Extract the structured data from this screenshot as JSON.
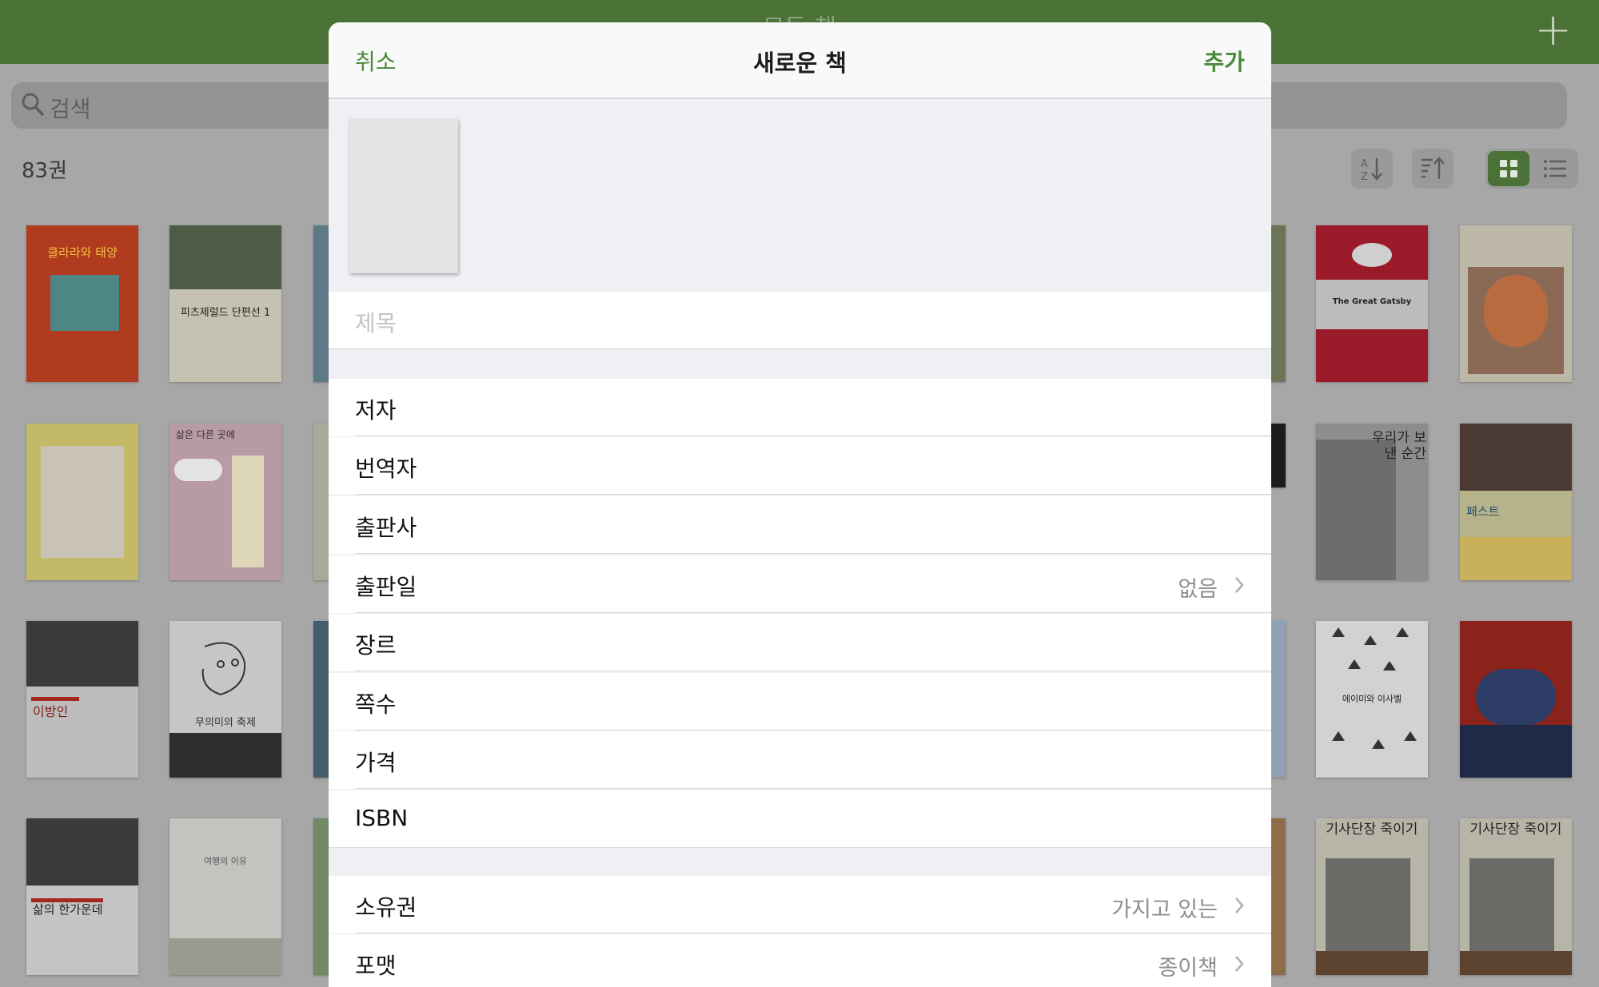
{
  "app": {
    "title": "모든 책",
    "search_placeholder": "검색",
    "book_count": "83권",
    "colors": {
      "accent": "#5a8a3c",
      "sheet_bg": "#efeff4"
    },
    "icons": [
      "plus-icon",
      "search-icon",
      "sort-alpha-icon",
      "sort-date-icon",
      "grid-view-icon",
      "list-view-icon"
    ]
  },
  "books": [
    {
      "title": "클라라와 태양"
    },
    {
      "title": "피츠제럴드 단편선 1"
    },
    {
      "title": "The Great Gatsby"
    },
    {
      "title": ""
    },
    {
      "title": ""
    },
    {
      "title": "삶은 다른 곳에"
    },
    {
      "title": "우리가 보낸 순간"
    },
    {
      "title": "페스트"
    },
    {
      "title": "이방인"
    },
    {
      "title": "무의미의 축제"
    },
    {
      "title": "에이미와 이사벨"
    },
    {
      "title": ""
    },
    {
      "title": "삶의 한가운데"
    },
    {
      "title": "여행의 이유"
    },
    {
      "title": "기사단장 죽이기"
    },
    {
      "title": "기사단장 죽이기"
    }
  ],
  "sheet": {
    "cancel": "취소",
    "title": "새로운 책",
    "add": "추가",
    "title_placeholder": "제목",
    "fields": {
      "author": "저자",
      "translator": "번역자",
      "publisher": "출판사",
      "pub_date": "출판일",
      "pub_date_value": "없음",
      "genre": "장르",
      "pages": "쪽수",
      "price": "가격",
      "isbn": "ISBN",
      "ownership": "소유권",
      "ownership_value": "가지고 있는",
      "format": "포맷",
      "format_value": "종이책"
    }
  }
}
